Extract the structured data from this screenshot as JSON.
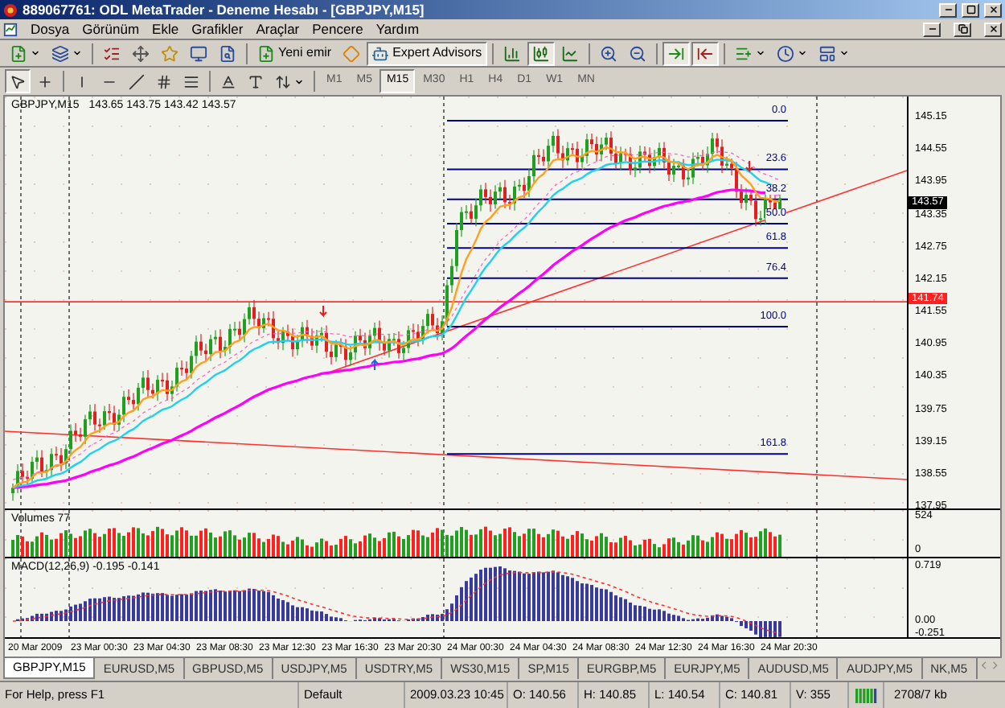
{
  "window": {
    "title": "889067761: ODL MetaTrader - Deneme Hesabı - [GBPJPY,M15]"
  },
  "menu": [
    "Dosya",
    "Görünüm",
    "Ekle",
    "Grafikler",
    "Araçlar",
    "Pencere",
    "Yardım"
  ],
  "toolbar": [
    {
      "pressed": false
    },
    {
      "pressed": false
    },
    {
      "pressed": false
    },
    {
      "pressed": false
    },
    {
      "pressed": false
    },
    {
      "pressed": false
    },
    {
      "pressed": false
    },
    {
      "label": "Yeni emir",
      "pressed": false
    },
    {
      "pressed": false
    },
    {
      "label": "Expert Advisors",
      "pressed": true
    },
    {
      "pressed": false
    },
    {
      "pressed": true
    },
    {
      "pressed": false
    },
    {
      "pressed": false
    },
    {
      "pressed": false
    },
    {
      "pressed": true
    },
    {
      "pressed": true
    },
    {
      "pressed": false
    },
    {
      "pressed": false
    },
    {
      "pressed": false
    }
  ],
  "drawing_tools": [
    {
      "pressed": true
    },
    {
      "pressed": false
    },
    {
      "pressed": false
    },
    {
      "pressed": false
    },
    {
      "pressed": false
    },
    {
      "pressed": false
    },
    {
      "pressed": false
    },
    {
      "pressed": false
    },
    {
      "pressed": false
    },
    {
      "pressed": false
    }
  ],
  "timeframes": [
    {
      "label": "M1",
      "selected": false
    },
    {
      "label": "M5",
      "selected": false
    },
    {
      "label": "M15",
      "selected": true
    },
    {
      "label": "M30",
      "selected": false
    },
    {
      "label": "H1",
      "selected": false
    },
    {
      "label": "H4",
      "selected": false
    },
    {
      "label": "D1",
      "selected": false
    },
    {
      "label": "W1",
      "selected": false
    },
    {
      "label": "MN",
      "selected": false
    }
  ],
  "chart": {
    "symbol": "GBPJPY,M15",
    "ohlc": "143.65 143.75 143.42 143.57",
    "fib_levels": [
      "0.0",
      "23.6",
      "38.2",
      "50.0",
      "61.8",
      "76.4",
      "100.0",
      "161.8"
    ],
    "price_ticks": [
      "145.15",
      "144.55",
      "143.95",
      "143.35",
      "142.75",
      "142.15",
      "141.55",
      "140.95",
      "140.35",
      "139.75",
      "139.15",
      "138.55",
      "137.95"
    ],
    "bid_price": "143.57",
    "line_price": "141.74"
  },
  "volumes": {
    "label": "Volumes 77",
    "ticks": [
      "524",
      "0"
    ]
  },
  "macd": {
    "label": "MACD(12,26,9) -0.195 -0.141",
    "ticks": [
      "0.719",
      "0.00",
      "-0.251"
    ]
  },
  "time_axis": [
    "20 Mar 2009",
    "23 Mar 00:30",
    "23 Mar 04:30",
    "23 Mar 08:30",
    "23 Mar 12:30",
    "23 Mar 16:30",
    "23 Mar 20:30",
    "24 Mar 00:30",
    "24 Mar 04:30",
    "24 Mar 08:30",
    "24 Mar 12:30",
    "24 Mar 16:30",
    "24 Mar 20:30"
  ],
  "tabs": [
    {
      "label": "GBPJPY,M15",
      "selected": true
    },
    {
      "label": "EURUSD,M5",
      "selected": false
    },
    {
      "label": "GBPUSD,M5",
      "selected": false
    },
    {
      "label": "USDJPY,M5",
      "selected": false
    },
    {
      "label": "USDTRY,M5",
      "selected": false
    },
    {
      "label": "WS30,M15",
      "selected": false
    },
    {
      "label": "SP,M15",
      "selected": false
    },
    {
      "label": "EURGBP,M5",
      "selected": false
    },
    {
      "label": "EURJPY,M5",
      "selected": false
    },
    {
      "label": "AUDUSD,M5",
      "selected": false
    },
    {
      "label": "AUDJPY,M5",
      "selected": false
    },
    {
      "label": "NK,M5",
      "selected": false
    }
  ],
  "status_bar": {
    "help": "For Help, press F1",
    "profile": "Default",
    "datetime": "2009.03.23 10:45",
    "open": "O: 140.56",
    "high": "H: 140.85",
    "low": "L: 140.54",
    "close": "C: 140.81",
    "volume": "V: 355",
    "traffic": "2708/7 kb"
  }
}
